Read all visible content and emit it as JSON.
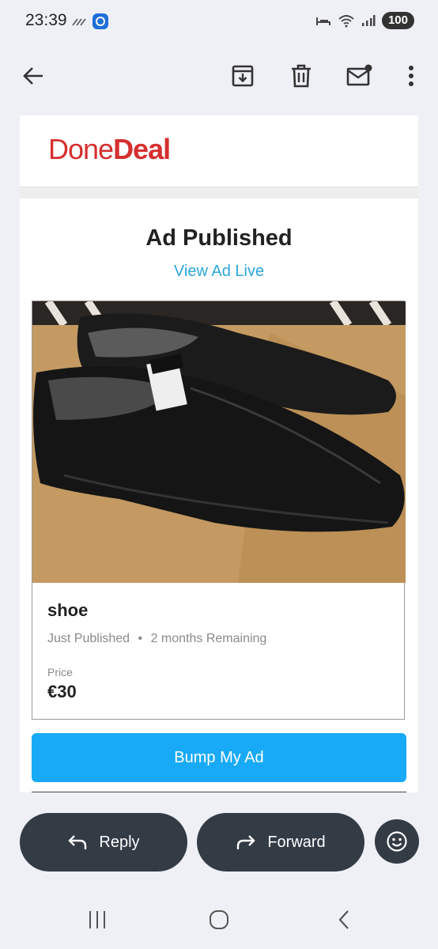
{
  "status_bar": {
    "time": "23:39",
    "battery": "100"
  },
  "email": {
    "brand": {
      "part1": "Done",
      "part2": "Deal"
    },
    "headline": "Ad Published",
    "view_link": "View Ad Live",
    "ad": {
      "title": "shoe",
      "status": "Just Published",
      "remaining": "2 months Remaining",
      "price_label": "Price",
      "price": "€30"
    },
    "bump_button": "Bump My Ad"
  },
  "actions": {
    "reply": "Reply",
    "forward": "Forward"
  },
  "colors": {
    "brand_red": "#d62f2f",
    "link_blue": "#2aa7dc",
    "button_blue": "#18aaf7",
    "pill_dark": "#333b45"
  }
}
